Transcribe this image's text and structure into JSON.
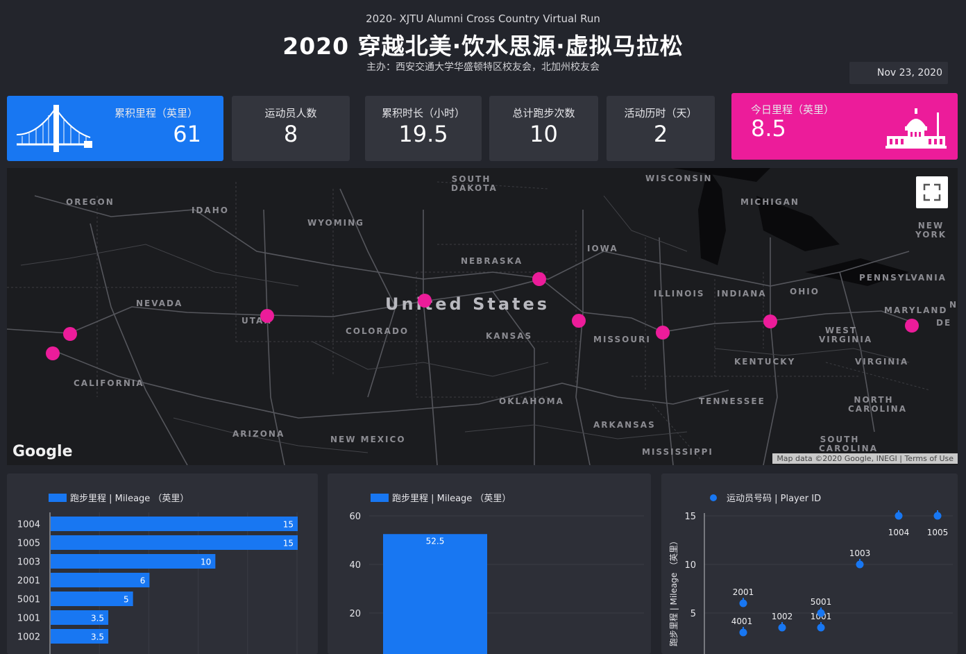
{
  "header": {
    "subtitle": "2020- XJTU Alumni Cross Country Virtual Run",
    "title": "2020 穿越北美·饮水思源·虚拟马拉松",
    "organizer": "主办：西安交通大学华盛顿特区校友会，北加州校友会",
    "date": "Nov 23, 2020"
  },
  "kpis": [
    {
      "label": "累积里程（英里）",
      "value": "61"
    },
    {
      "label": "运动员人数",
      "value": "8"
    },
    {
      "label": "累积时长（小时）",
      "value": "19.5"
    },
    {
      "label": "总计跑步次数",
      "value": "10"
    },
    {
      "label": "活动历时（天）",
      "value": "2"
    },
    {
      "label": "今日里程（英里）",
      "value": "8.5"
    }
  ],
  "colors": {
    "accent_blue": "#1877f2",
    "accent_pink": "#ec1c9a",
    "background": "#23252c",
    "panel": "#2d2f37"
  },
  "map": {
    "country_label": "United States",
    "states": [
      "OREGON",
      "IDAHO",
      "WYOMING",
      "SOUTH DAKOTA",
      "WISCONSIN",
      "MICHIGAN",
      "NEW YORK",
      "IOWA",
      "NEBRASKA",
      "PENNSYLVANIA",
      "NEVADA",
      "UTAH",
      "COLORADO",
      "KANSAS",
      "ILLINOIS",
      "INDIANA",
      "OHIO",
      "MARYLAND",
      "DE",
      "N",
      "MISSOURI",
      "WEST VIRGINIA",
      "KENTUCKY",
      "VIRGINIA",
      "CALIFORNIA",
      "OKLAHOMA",
      "TENNESSEE",
      "NORTH CAROLINA",
      "ARIZONA",
      "NEW MEXICO",
      "ARKANSAS",
      "SOUTH CAROLINA",
      "MISSISSIPPI"
    ],
    "logo": "Google",
    "attribution": "Map data ©2020 Google, INEGI | Terms of Use",
    "fullscreen_icon": "fullscreen-icon"
  },
  "chart_data": [
    {
      "type": "bar",
      "orientation": "horizontal",
      "legend": "跑步里程 | Mileage （英里）",
      "categories": [
        "1004",
        "1005",
        "1003",
        "2001",
        "5001",
        "1001",
        "1002"
      ],
      "series": [
        {
          "name": "跑步里程 | Mileage （英里）",
          "values": [
            15,
            15,
            10,
            6,
            5,
            3.5,
            3.5
          ]
        }
      ],
      "data_labels": [
        "15",
        "15",
        "10",
        "6",
        "5",
        "3.5",
        "3.5"
      ],
      "xlim": [
        0,
        15
      ],
      "grid": true
    },
    {
      "type": "bar",
      "legend": "跑步里程 | Mileage （英里）",
      "categories": [
        ""
      ],
      "series": [
        {
          "name": "跑步里程 | Mileage （英里）",
          "values": [
            52.5
          ]
        }
      ],
      "data_labels": [
        "52.5"
      ],
      "ylim": [
        0,
        60
      ],
      "yticks": [
        "60",
        "40",
        "20"
      ],
      "grid": true
    },
    {
      "type": "scatter",
      "legend": "运动员号码 | Player ID",
      "ylabel": "跑步里程 | Mileage （英里）",
      "yticks": [
        "15",
        "10",
        "5"
      ],
      "ylim": [
        0,
        15
      ],
      "points": [
        {
          "label": "2001",
          "x": 1,
          "y": 6
        },
        {
          "label": "4001",
          "x": 1,
          "y": 3
        },
        {
          "label": "1002",
          "x": 2,
          "y": 3.5
        },
        {
          "label": "1001",
          "x": 3,
          "y": 3.5
        },
        {
          "label": "5001",
          "x": 3,
          "y": 5
        },
        {
          "label": "1003",
          "x": 4,
          "y": 10
        },
        {
          "label": "1004",
          "x": 5,
          "y": 15
        },
        {
          "label": "1005",
          "x": 6,
          "y": 15
        }
      ]
    }
  ]
}
